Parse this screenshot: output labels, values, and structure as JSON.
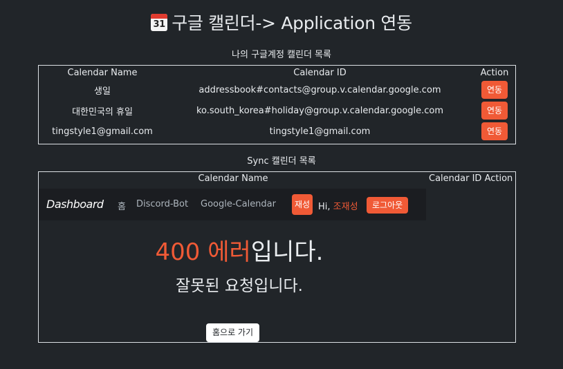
{
  "header": {
    "icon": "calendar-icon",
    "icon_number": "31",
    "title": "구글 캘린더-> Application 연동"
  },
  "my_calendars": {
    "caption": "나의 구글계정 캘린더 목록",
    "columns": [
      "Calendar Name",
      "Calendar ID",
      "Action"
    ],
    "rows": [
      {
        "name": "생일",
        "id": "addressbook#contacts@group.v.calendar.google.com",
        "action": "연동"
      },
      {
        "name": "대한민국의 휴일",
        "id": "ko.south_korea#holiday@group.v.calendar.google.com",
        "action": "연동"
      },
      {
        "name": "tingstyle1@gmail.com",
        "id": "tingstyle1@gmail.com",
        "action": "연동"
      }
    ]
  },
  "sync_calendars": {
    "caption": "Sync 캘린더 목록",
    "columns": [
      "Calendar Name",
      "Calendar ID",
      "Action"
    ]
  },
  "embedded_page": {
    "brand": "Dashboard",
    "nav": [
      "홈",
      "Discord-Bot",
      "Google-Calendar"
    ],
    "resync_button": "재성",
    "greeting_prefix": "Hi,",
    "user_name": "조재성",
    "logout_button": "로그아웃",
    "error_code": "400 에러",
    "error_suffix": "입니다.",
    "error_message": "잘못된 요청입니다.",
    "home_button": "홈으로 가기"
  },
  "colors": {
    "background": "#212529",
    "accent": "#f05a36",
    "text": "#e9ecef"
  }
}
